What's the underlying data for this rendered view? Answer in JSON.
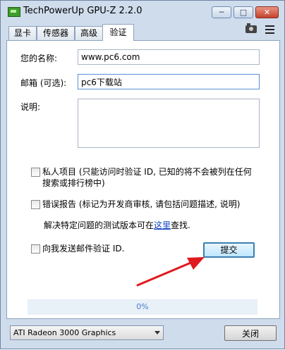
{
  "window": {
    "title": "TechPowerUp GPU-Z 2.2.0",
    "controls": {
      "minimize": "─",
      "maximize": "□",
      "close": "✕"
    }
  },
  "tabs": [
    {
      "label": "显卡",
      "active": false
    },
    {
      "label": "传感器",
      "active": false
    },
    {
      "label": "高级",
      "active": false
    },
    {
      "label": "验证",
      "active": true
    }
  ],
  "form": {
    "name_label": "您的名称:",
    "name_value": "www.pc6.com",
    "email_label": "邮箱 (可选):",
    "email_value": "pc6下载站",
    "description_label": "说明:",
    "description_value": ""
  },
  "options": {
    "private_line1": "私人项目 (只能访问时验证 ID, 已知的将不会被列在任何",
    "private_line2": "搜索或排行榜中)",
    "private_checked": false,
    "bug_report": "错误报告 (标记为开发商审核, 请包括问题描述, 说明)",
    "bug_checked": false,
    "hint_prefix": "解决特定问题的测试版本可在",
    "hint_link": "这里",
    "hint_suffix": "查找.",
    "email_me": "向我发送邮件验证 ID.",
    "email_me_checked": false
  },
  "submit_label": "提交",
  "progress": {
    "text": "0%",
    "value": 0
  },
  "footer": {
    "gpu_select": "ATI Radeon 3000 Graphics",
    "close_label": "关闭"
  },
  "colors": {
    "window_bg": "#cfdcec",
    "annotation_arrow": "#e0191e",
    "link": "#0b3fc2"
  }
}
